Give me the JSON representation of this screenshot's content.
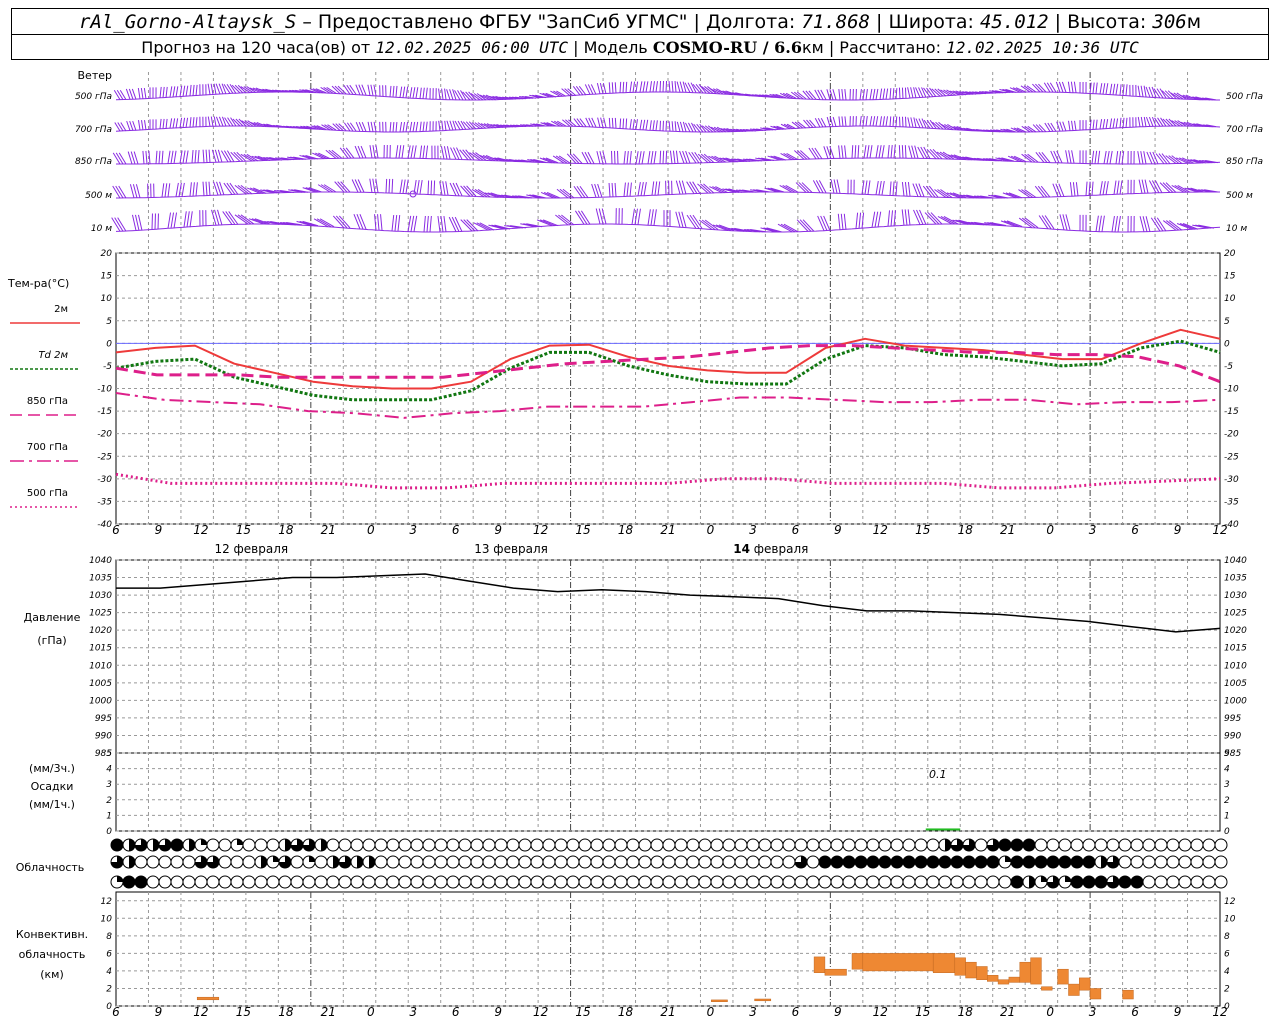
{
  "header": {
    "station": "rAl_Gorno-Altaysk_S",
    "provider": "– Предоставлено ФГБУ \"ЗапСиб УГМС\" |",
    "lon_label": "Долгота:",
    "lon": "71.868",
    "lat_label": "| Широта:",
    "lat": "45.012",
    "alt_label": "| Высота:",
    "alt": "306",
    "alt_unit": "м",
    "forecast_label": "Прогноз на 120 часа(ов) от",
    "forecast_start": "12.02.2025 06:00 UTC",
    "model_label": "| Модель",
    "model": "COSMO-RU / 6.6",
    "model_unit": "км",
    "calc_label": "| Рассчитано:",
    "calc_time": "12.02.2025 10:36 UTC"
  },
  "chart_data": [
    {
      "type": "line",
      "panel": "wind",
      "title": "Ветер",
      "levels": [
        "500 гПа",
        "700 гПа",
        "850 гПа",
        "500 м",
        "10 м"
      ]
    },
    {
      "type": "line",
      "panel": "temperature",
      "title": "Тем-ра(°C)",
      "ylim": [
        -40,
        20
      ],
      "yticks": [
        -40,
        -35,
        -30,
        -25,
        -20,
        -15,
        -10,
        -5,
        0,
        5,
        10,
        15,
        20
      ],
      "x_hours": [
        0,
        3,
        6,
        9,
        12,
        15,
        18,
        21,
        24,
        27,
        30,
        33,
        36,
        39,
        42,
        45,
        48,
        51,
        54,
        57,
        60,
        63,
        66,
        69,
        72,
        75,
        78
      ],
      "series": [
        {
          "name": "2м",
          "color": "#ee3a3a",
          "style": "solid",
          "values": [
            -2,
            -1,
            -0.5,
            -4.5,
            -6.5,
            -8.5,
            -9.5,
            -10,
            -10,
            -8.5,
            -3.5,
            -0.5,
            -0.3,
            -3,
            -5,
            -6,
            -6.5,
            -6.5,
            -1,
            1,
            -0.5,
            -1,
            -1.5,
            -2.5,
            -3.5,
            -3.5,
            0,
            3,
            1
          ]
        },
        {
          "name": "Td  2м",
          "color": "#117711",
          "style": "dotted",
          "values": [
            -5.5,
            -4,
            -3.5,
            -7.5,
            -9.5,
            -11.5,
            -12.5,
            -12.5,
            -12.5,
            -10.5,
            -5.5,
            -2,
            -2,
            -5,
            -7,
            -8.5,
            -9,
            -9,
            -3.5,
            -0.5,
            -1,
            -2.5,
            -3,
            -4,
            -5,
            -4.5,
            -1,
            0.5,
            -2
          ]
        },
        {
          "name": "850 гПа",
          "color": "#dd1f8a",
          "style": "dash",
          "values": [
            -5.5,
            -7,
            -7,
            -7,
            -7.5,
            -7.5,
            -7.5,
            -7.5,
            -7.5,
            -6.5,
            -5.5,
            -4.5,
            -4,
            -3.5,
            -3,
            -2,
            -1,
            -0.5,
            -0.5,
            -1,
            -1.5,
            -2,
            -2,
            -2.5,
            -2.5,
            -3,
            -5,
            -8.5
          ]
        },
        {
          "name": "700 гПа",
          "color": "#dd1f8a",
          "style": "dashdot",
          "values": [
            -11,
            -12.5,
            -13,
            -13.5,
            -15,
            -15.5,
            -16.5,
            -15.5,
            -15,
            -14,
            -14,
            -14,
            -13,
            -12,
            -12,
            -12.5,
            -13,
            -13,
            -12.5,
            -12.5,
            -13.5,
            -13,
            -13,
            -12.5
          ]
        },
        {
          "name": "500 гПа",
          "color": "#dd1f8a",
          "style": "dots",
          "values": [
            -29,
            -31,
            -31,
            -31,
            -31,
            -32,
            -32,
            -31,
            -31,
            -31,
            -31,
            -30,
            -30,
            -31,
            -31,
            -31,
            -32,
            -32,
            -31,
            -30.5,
            -30
          ]
        }
      ]
    },
    {
      "type": "line",
      "panel": "pressure",
      "title": "Давление",
      "ylabel": "(гПа)",
      "ylim": [
        985,
        1040
      ],
      "yticks": [
        985,
        990,
        995,
        1000,
        1005,
        1010,
        1015,
        1020,
        1025,
        1030,
        1035,
        1040
      ],
      "series": [
        {
          "name": "Давление",
          "color": "#000000",
          "values": [
            1032,
            1032,
            1033,
            1034,
            1035,
            1035,
            1035.5,
            1036,
            1034,
            1032,
            1031,
            1031.5,
            1031,
            1030,
            1029.5,
            1029,
            1027,
            1025.5,
            1025.5,
            1025,
            1024.5,
            1023.5,
            1022.5,
            1021,
            1019.5,
            1020.5
          ]
        }
      ]
    },
    {
      "type": "bar",
      "panel": "precipitation",
      "title": "Осадки",
      "ylabel_top": "(мм/3ч.)",
      "ylabel_bottom": "(мм/1ч.)",
      "ylim": [
        0,
        5
      ],
      "yticks": [
        0,
        1,
        2,
        3,
        4,
        5
      ],
      "annotation": "0.1",
      "bars": [
        {
          "hour": 75,
          "value": 0.1,
          "color": "#22bb22"
        }
      ]
    },
    {
      "type": "heatmap",
      "panel": "cloud",
      "title": "Облачность",
      "rows": 3,
      "scale": "0 = ясно, 1 = четверть, 2 = половина, 3 = три четверти, 4 = сплошная"
    },
    {
      "type": "bar",
      "panel": "convective",
      "title": "Конвективн.",
      "subtitle": "облачность",
      "ylabel": "(км)",
      "ylim": [
        0,
        13
      ],
      "yticks": [
        0,
        2,
        4,
        6,
        8,
        10,
        12
      ],
      "bars": [
        {
          "start": 7.5,
          "end": 9.5,
          "bottom": 0.7,
          "top": 1.0
        },
        {
          "start": 55,
          "end": 56.5,
          "bottom": 0.5,
          "top": 0.7
        },
        {
          "start": 59,
          "end": 60.5,
          "bottom": 0.6,
          "top": 0.8
        },
        {
          "start": 64.5,
          "end": 65.5,
          "bottom": 3.8,
          "top": 5.6
        },
        {
          "start": 65.5,
          "end": 67.5,
          "bottom": 3.5,
          "top": 4.2
        },
        {
          "start": 68,
          "end": 69,
          "bottom": 4.2,
          "top": 6.0
        },
        {
          "start": 69,
          "end": 75.5,
          "bottom": 4.0,
          "top": 6.0
        },
        {
          "start": 75.5,
          "end": 77.5,
          "bottom": 3.8,
          "top": 6.0
        },
        {
          "start": 77.5,
          "end": 78.5,
          "bottom": 3.5,
          "top": 5.5
        },
        {
          "start": 78.5,
          "end": 79.5,
          "bottom": 3.2,
          "top": 5.0
        },
        {
          "start": 79.5,
          "end": 80.5,
          "bottom": 3.0,
          "top": 4.5
        },
        {
          "start": 80.5,
          "end": 81.5,
          "bottom": 2.8,
          "top": 3.5
        },
        {
          "start": 81.5,
          "end": 82.5,
          "bottom": 2.5,
          "top": 3.0
        },
        {
          "start": 82.5,
          "end": 83.5,
          "bottom": 2.7,
          "top": 3.3
        },
        {
          "start": 83.5,
          "end": 84.5,
          "bottom": 2.7,
          "top": 5.0
        },
        {
          "start": 84.5,
          "end": 85.5,
          "bottom": 2.5,
          "top": 5.5
        },
        {
          "start": 85.5,
          "end": 86.5,
          "bottom": 1.8,
          "top": 2.2
        },
        {
          "start": 87,
          "end": 88,
          "bottom": 2.5,
          "top": 4.2
        },
        {
          "start": 88,
          "end": 89,
          "bottom": 1.2,
          "top": 2.5
        },
        {
          "start": 89,
          "end": 90,
          "bottom": 1.8,
          "top": 3.2
        },
        {
          "start": 90,
          "end": 91,
          "bottom": 0.8,
          "top": 2.0
        },
        {
          "start": 93,
          "end": 94,
          "bottom": 0.8,
          "top": 1.8
        }
      ]
    }
  ],
  "time_axis": {
    "hour_ticks": [
      "6",
      "9",
      "12",
      "15",
      "18",
      "21",
      "0",
      "3",
      "6",
      "9",
      "12",
      "15",
      "18",
      "21",
      "0",
      "3",
      "6",
      "9",
      "12",
      "15",
      "18",
      "21",
      "0",
      "3",
      "6",
      "9",
      "12"
    ],
    "days": [
      {
        "label_pre": "12 февраля",
        "label_bold": "",
        "label": "",
        "at_hour": 12
      },
      {
        "label_pre": "13 февраля",
        "label_bold": "",
        "label": "",
        "at_hour": 36
      },
      {
        "label_pre": "",
        "label_bold": "14",
        "label": " февраля",
        "at_hour": 60
      }
    ]
  },
  "colors": {
    "wind": "#8a2be2",
    "t2m": "#ee3a3a",
    "td2m": "#117711",
    "upper": "#dd1f8a",
    "pressure": "#000000",
    "precip": "#22bb22",
    "convective": "#ee8833",
    "grid": "#999999"
  },
  "cloud_rows": [
    [
      4,
      2,
      3,
      2,
      3,
      4,
      2,
      1,
      0,
      0,
      1,
      0,
      0,
      0,
      2,
      3,
      3,
      2,
      0,
      0,
      0,
      0,
      0,
      0,
      0,
      0,
      0,
      0,
      0,
      0,
      0,
      0,
      0,
      0,
      0,
      0,
      0,
      0,
      0,
      0,
      0,
      0,
      0,
      0,
      0,
      0,
      0,
      0,
      0,
      0,
      0,
      0,
      0,
      0,
      0,
      0,
      0,
      0,
      0,
      0,
      0,
      0,
      0,
      0,
      0,
      0,
      0,
      0,
      0,
      2,
      3,
      3,
      0,
      3,
      4,
      4,
      4,
      0,
      0,
      0,
      0,
      0,
      0,
      0,
      0,
      0,
      0,
      0,
      0,
      0,
      0,
      0,
      0
    ],
    [
      3,
      2,
      0,
      0,
      0,
      0,
      0,
      3,
      3,
      0,
      0,
      0,
      2,
      1,
      3,
      0,
      1,
      0,
      2,
      3,
      2,
      2,
      0,
      0,
      0,
      0,
      0,
      0,
      0,
      0,
      0,
      0,
      0,
      0,
      0,
      0,
      0,
      0,
      0,
      0,
      0,
      0,
      0,
      0,
      0,
      0,
      0,
      0,
      0,
      0,
      0,
      0,
      0,
      0,
      0,
      0,
      0,
      3,
      0,
      4,
      4,
      4,
      4,
      4,
      4,
      4,
      4,
      4,
      4,
      4,
      4,
      4,
      4,
      4,
      1,
      4,
      4,
      4,
      4,
      4,
      4,
      4,
      2,
      3,
      0,
      0,
      0,
      0,
      0,
      0,
      0,
      0,
      0
    ],
    [
      1,
      4,
      4,
      0,
      0,
      0,
      0,
      0,
      0,
      0,
      0,
      0,
      0,
      0,
      0,
      0,
      0,
      0,
      0,
      0,
      0,
      0,
      0,
      0,
      0,
      0,
      0,
      0,
      0,
      0,
      0,
      0,
      0,
      0,
      0,
      0,
      0,
      0,
      0,
      0,
      0,
      0,
      0,
      0,
      0,
      0,
      0,
      0,
      0,
      0,
      0,
      0,
      0,
      0,
      0,
      0,
      0,
      0,
      0,
      0,
      0,
      0,
      0,
      0,
      0,
      0,
      0,
      0,
      0,
      0,
      0,
      0,
      0,
      0,
      0,
      4,
      2,
      1,
      3,
      1,
      4,
      4,
      4,
      3,
      4,
      4,
      0,
      0,
      0,
      0,
      0,
      0,
      0
    ]
  ]
}
